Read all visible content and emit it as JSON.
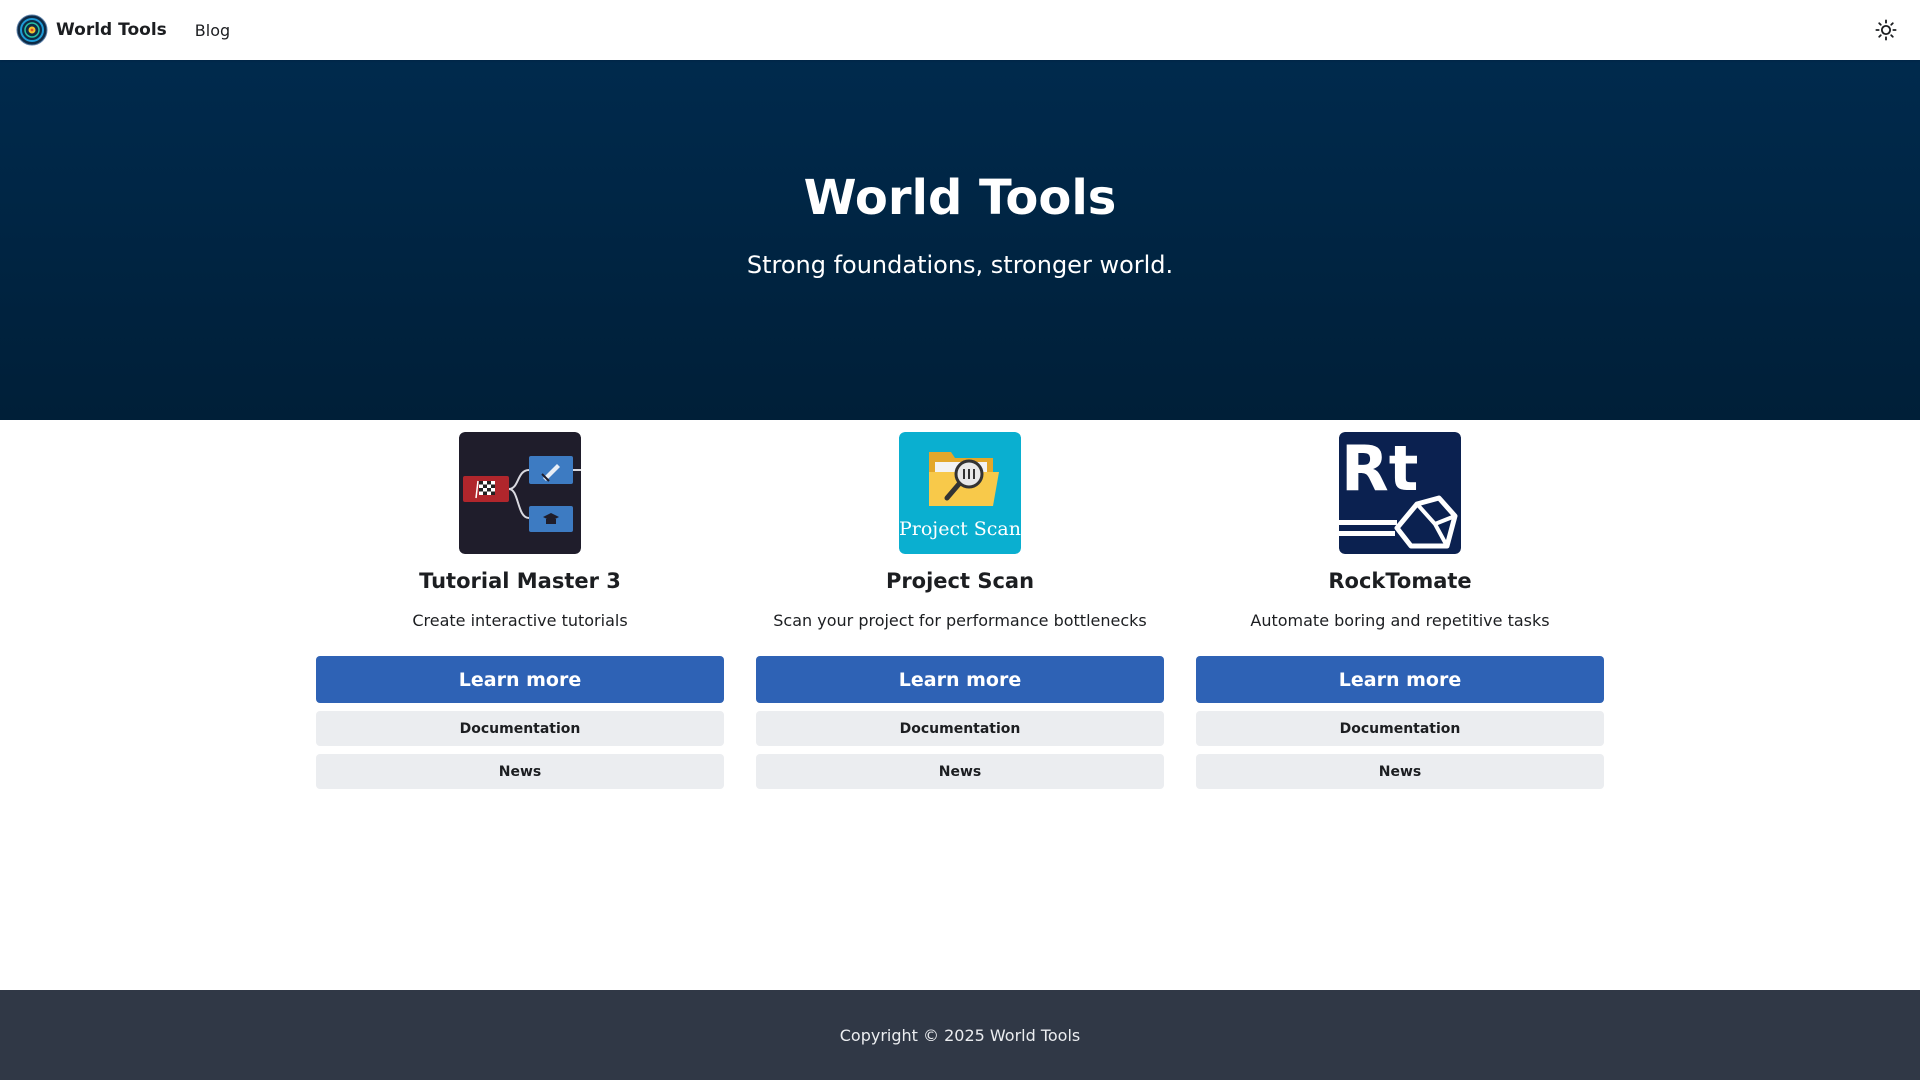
{
  "navbar": {
    "brand_title": "World Tools",
    "links": [
      {
        "label": "Blog"
      }
    ],
    "brand_logo_icon": "world-tools-logo-icon",
    "theme_icon": "sun-icon"
  },
  "hero": {
    "title": "World Tools",
    "subtitle": "Strong foundations, stronger world."
  },
  "products": [
    {
      "name": "Tutorial Master 3",
      "description": "Create interactive tutorials",
      "learn_more": "Learn more",
      "documentation": "Documentation",
      "news": "News",
      "logo_icon": "tutorial-flowchart-icon"
    },
    {
      "name": "Project Scan",
      "description": "Scan your project for performance bottlenecks",
      "learn_more": "Learn more",
      "documentation": "Documentation",
      "news": "News",
      "logo_icon": "folder-magnifier-icon",
      "logo_caption": "Project Scan"
    },
    {
      "name": "RockTomate",
      "description": "Automate boring and repetitive tasks",
      "learn_more": "Learn more",
      "documentation": "Documentation",
      "news": "News",
      "logo_icon": "rt-rock-icon",
      "logo_text": "Rt"
    }
  ],
  "footer": {
    "copyright": "Copyright © 2025 World Tools"
  },
  "colors": {
    "hero_bg": "#002a4d",
    "primary_button": "#2e62b5",
    "secondary_button": "#ebedf0",
    "footer_bg": "#303846",
    "tm3_bg": "#1f1d2b",
    "ps_bg": "#0aafd0",
    "rt_bg": "#0b2150"
  }
}
